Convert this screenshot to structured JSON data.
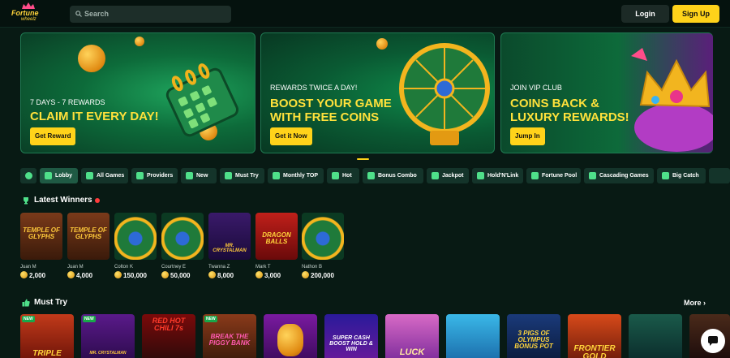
{
  "header": {
    "logo_line1": "Fortune",
    "logo_line2": "wheelz",
    "search_placeholder": "Search",
    "login_label": "Login",
    "signup_label": "Sign Up"
  },
  "banners": [
    {
      "subtitle": "7 DAYS - 7 REWARDS",
      "title": "CLAIM IT EVERY DAY!",
      "button": "Get Reward"
    },
    {
      "subtitle": "REWARDS TWICE A DAY!",
      "title_line1": "BOOST YOUR GAME",
      "title_line2": "WITH FREE COINS",
      "button": "Get it Now"
    },
    {
      "subtitle": "JOIN VIP CLUB",
      "title_line1": "COINS BACK &",
      "title_line2": "LUXURY REWARDS!",
      "button": "Jump In"
    }
  ],
  "categories": [
    {
      "label": ""
    },
    {
      "label": "Lobby"
    },
    {
      "label": "All Games"
    },
    {
      "label": "Providers"
    },
    {
      "label": "New"
    },
    {
      "label": "Must Try"
    },
    {
      "label": "Monthly TOP"
    },
    {
      "label": "Hot"
    },
    {
      "label": "Bonus Combo"
    },
    {
      "label": "Jackpot"
    },
    {
      "label": "Hold'N'Link"
    },
    {
      "label": "Fortune Pool"
    },
    {
      "label": "Cascading Games"
    },
    {
      "label": "Big Catch"
    }
  ],
  "latest_winners": {
    "title": "Latest Winners",
    "items": [
      {
        "name": "Juan M",
        "amount": "2,000",
        "tile": "TEMPLE OF GLYPHS"
      },
      {
        "name": "Juan M",
        "amount": "4,000",
        "tile": "TEMPLE OF GLYPHS"
      },
      {
        "name": "Colton K",
        "amount": "150,000",
        "tile": ""
      },
      {
        "name": "Courtney E",
        "amount": "50,000",
        "tile": ""
      },
      {
        "name": "Twanna Z",
        "amount": "8,000",
        "tile": "MR. CRYSTALMAN"
      },
      {
        "name": "Mark T",
        "amount": "3,000",
        "tile": "DRAGON BALLS"
      },
      {
        "name": "Nathon B",
        "amount": "200,000",
        "tile": ""
      }
    ]
  },
  "must_try": {
    "title": "Must Try",
    "more_label": "More",
    "games": [
      {
        "tile": "TRIPLE",
        "badge": "NEW"
      },
      {
        "tile": "MR. CRYSTALMAN",
        "badge": "NEW"
      },
      {
        "tile": "RED HOT CHILI 7s",
        "badge": ""
      },
      {
        "tile": "BREAK THE PIGGY BANK",
        "badge": "NEW"
      },
      {
        "tile": "",
        "badge": ""
      },
      {
        "tile": "SUPER CASH BOOST HOLD & WIN",
        "badge": ""
      },
      {
        "tile": "LUCK",
        "badge": ""
      },
      {
        "tile": "",
        "badge": ""
      },
      {
        "tile": "3 PIGS OF OLYMPUS BONUS POT",
        "badge": ""
      },
      {
        "tile": "FRONTIER GOLD",
        "badge": ""
      },
      {
        "tile": "",
        "badge": ""
      }
    ]
  },
  "colors": {
    "accent": "#ffd31a",
    "background": "#081a14",
    "live": "#ff3b3b"
  }
}
